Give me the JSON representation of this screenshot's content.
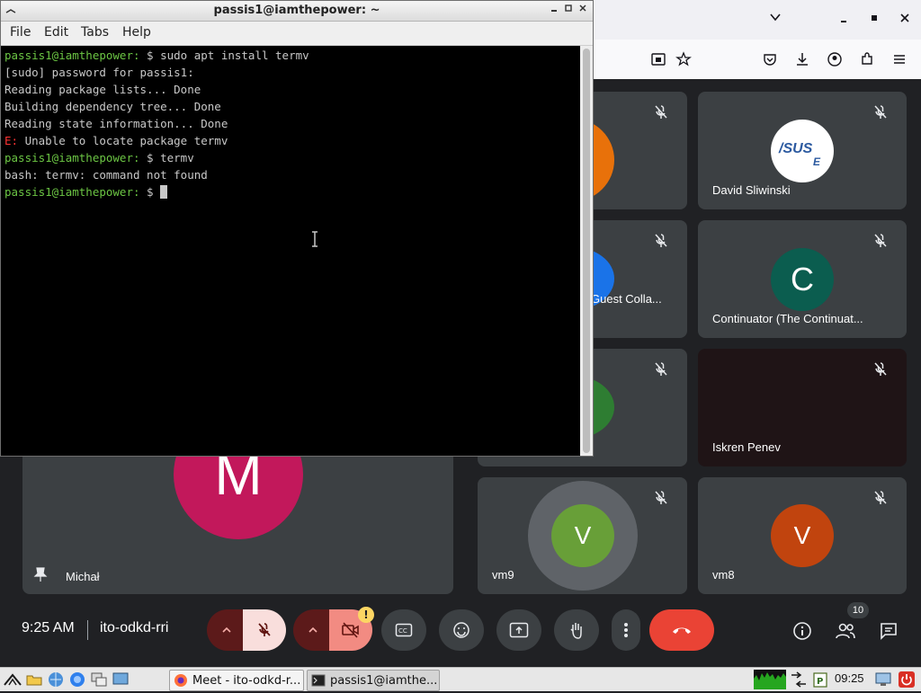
{
  "terminal": {
    "title": "passis1@iamthepower: ~",
    "menu": [
      "File",
      "Edit",
      "Tabs",
      "Help"
    ],
    "lines": [
      {
        "prompt": "passis1@iamthepower:",
        "text": " $ sudo apt install termv"
      },
      {
        "text": "[sudo] password for passis1:"
      },
      {
        "text": "Reading package lists... Done"
      },
      {
        "text": "Building dependency tree... Done"
      },
      {
        "text": "Reading state information... Done"
      },
      {
        "err": "E:",
        "text": " Unable to locate package termv"
      },
      {
        "prompt": "passis1@iamthepower:",
        "text": " $ termv"
      },
      {
        "text": "bash: termv: command not found"
      },
      {
        "prompt": "passis1@iamthepower:",
        "text": " $ "
      }
    ]
  },
  "meet": {
    "tiles": [
      {
        "name": "",
        "initial": "",
        "color": "#e8710a"
      },
      {
        "name": "David Sliwinski",
        "initial": "",
        "color": "#ffffff"
      },
      {
        "name": "Guest Colla...",
        "initial": "",
        "color": "#1a73e8"
      },
      {
        "name": "Continuator (The Continuat...",
        "initial": "C",
        "color": "#0b5d4f"
      },
      {
        "name": "",
        "initial": "",
        "color": "#2e7d32"
      },
      {
        "name": "Iskren Penev",
        "initial": "",
        "color": "#1f1416"
      },
      {
        "name": "Michał",
        "initial": "M",
        "color": "#c2185b"
      },
      {
        "name": "vm9",
        "initial": "V",
        "color": "#689f38"
      },
      {
        "name": "vm8",
        "initial": "V",
        "color": "#c1440e"
      }
    ],
    "time": "9:25 AM",
    "meeting_code": "ito-odkd-rri",
    "people_count": "10",
    "warning_badge": "!"
  },
  "taskbar": {
    "tasks": [
      "Meet - ito-odkd-r...",
      "passis1@iamthe..."
    ],
    "clock": "09:25"
  },
  "colors": {
    "end_call": "#ea4335",
    "prompt": "#6cc644",
    "error": "#ff3333"
  }
}
